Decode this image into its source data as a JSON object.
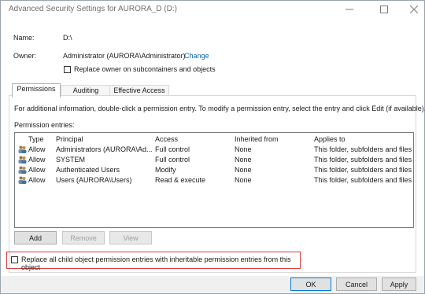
{
  "window": {
    "title": "Advanced Security Settings for AURORA_D (D:)"
  },
  "name_row": {
    "label": "Name:",
    "value": "D:\\"
  },
  "owner_row": {
    "label": "Owner:",
    "value": "Administrator (AURORA\\Administrator)",
    "change_link": "Change"
  },
  "replace_owner": {
    "label": "Replace owner on subcontainers and objects",
    "checked": false
  },
  "tabs": [
    {
      "label": "Permissions",
      "active": true
    },
    {
      "label": "Auditing",
      "active": false
    },
    {
      "label": "Effective Access",
      "active": false
    }
  ],
  "permissions": {
    "info": "For additional information, double-click a permission entry. To modify a permission entry, select the entry and click Edit (if available).",
    "entries_label": "Permission entries:",
    "columns": [
      "Type",
      "Principal",
      "Access",
      "Inherited from",
      "Applies to"
    ],
    "rows": [
      {
        "type": "Allow",
        "principal": "Administrators (AURORA\\Ad...",
        "access": "Full control",
        "inherited": "None",
        "applies": "This folder, subfolders and files"
      },
      {
        "type": "Allow",
        "principal": "SYSTEM",
        "access": "Full control",
        "inherited": "None",
        "applies": "This folder, subfolders and files"
      },
      {
        "type": "Allow",
        "principal": "Authenticated Users",
        "access": "Modify",
        "inherited": "None",
        "applies": "This folder, subfolders and files"
      },
      {
        "type": "Allow",
        "principal": "Users (AURORA\\Users)",
        "access": "Read & execute",
        "inherited": "None",
        "applies": "This folder, subfolders and files"
      }
    ],
    "buttons": {
      "add": "Add",
      "remove": "Remove",
      "view": "View"
    }
  },
  "replace_child": {
    "label": "Replace all child object permission entries with inheritable permission entries from this object",
    "checked": false,
    "highlight_color": "#d93c3c"
  },
  "footer": {
    "ok": "OK",
    "cancel": "Cancel",
    "apply": "Apply"
  },
  "icons": {
    "minimize": "minimize-icon",
    "maximize": "maximize-icon",
    "close": "close-icon",
    "user": "user-group-icon"
  },
  "colors": {
    "link": "#0067b8",
    "accent": "#0078d7"
  }
}
